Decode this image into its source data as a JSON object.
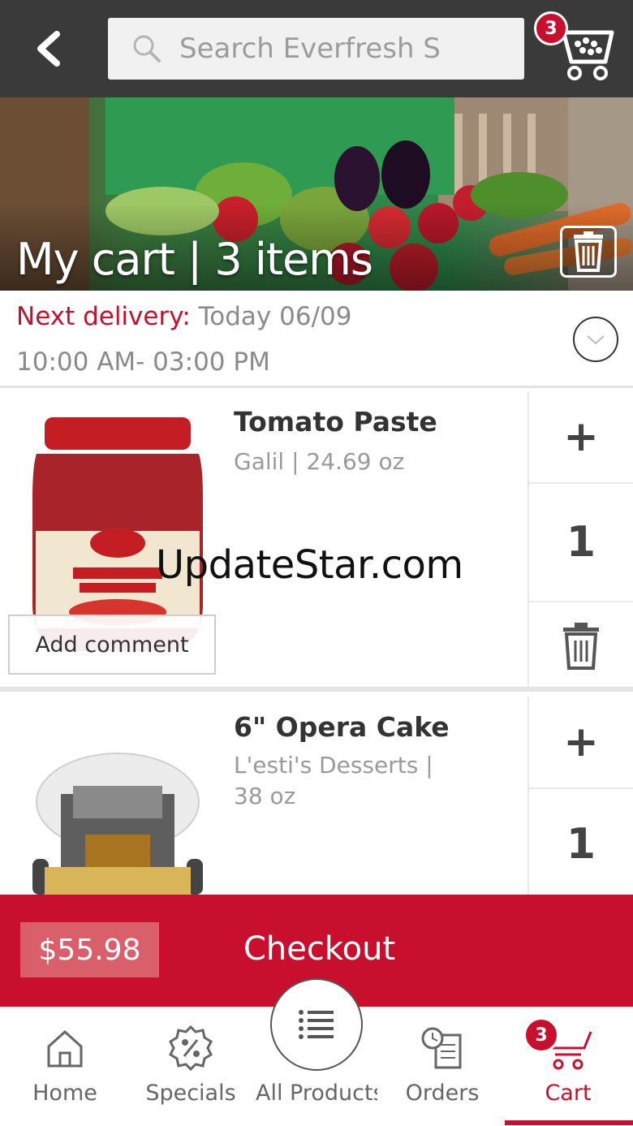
{
  "search": {
    "placeholder": "Search Everfresh S"
  },
  "header": {
    "cart_count": "3"
  },
  "hero": {
    "title": "My cart | 3 items"
  },
  "delivery": {
    "label": "Next delivery:",
    "date": "Today 06/09",
    "window": "10:00 AM- 03:00 PM"
  },
  "items": [
    {
      "name": "Tomato Paste",
      "meta": "Galil | 24.69 oz",
      "qty": "1",
      "plus": "+",
      "comment_label": "Add comment"
    },
    {
      "name": "6\" Opera Cake",
      "meta_line1": "L'esti's Desserts |",
      "meta_line2": "38 oz",
      "qty": "1",
      "plus": "+"
    }
  ],
  "watermark": "UpdateStar.com",
  "checkout": {
    "price": "$55.98",
    "label": "Checkout"
  },
  "nav": {
    "home": "Home",
    "specials": "Specials",
    "all_products": "All Products",
    "orders": "Orders",
    "cart": "Cart",
    "cart_count": "3"
  },
  "colors": {
    "accent": "#c8102e",
    "topbar": "#3a3a3a",
    "price_box": "#d9606b"
  },
  "icons": [
    "back-arrow-icon",
    "search-icon",
    "cart-icon",
    "trash-icon",
    "chevron-down-icon",
    "plus-icon",
    "home-icon",
    "percent-icon",
    "list-icon",
    "orders-clock-icon"
  ]
}
